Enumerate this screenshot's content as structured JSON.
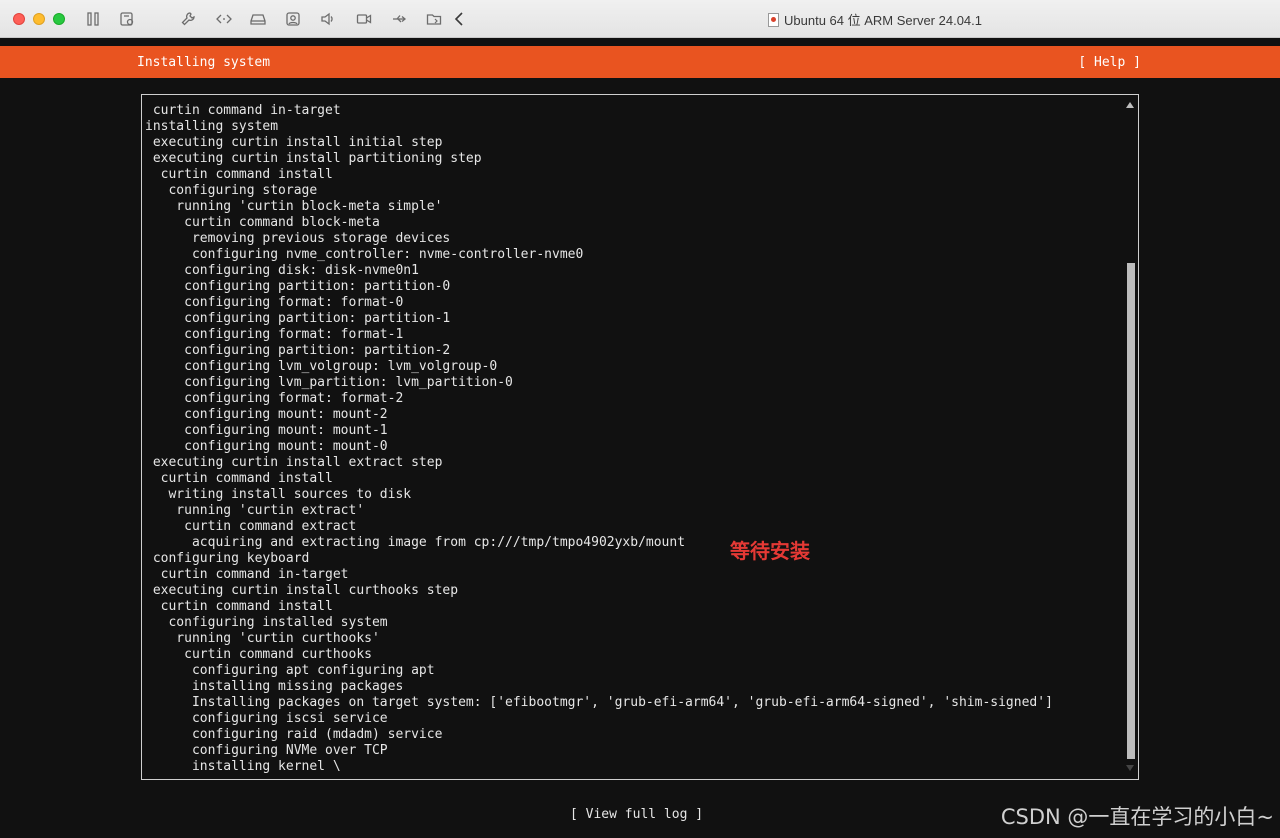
{
  "window": {
    "title": "Ubuntu 64 位 ARM Server 24.04.1",
    "toolbar_icons": [
      "pause-icon",
      "settings-icon",
      "wrench-icon",
      "code-icon",
      "drive-icon",
      "camera-icon",
      "sound-icon",
      "video-icon",
      "usb-icon",
      "shared-folder-icon",
      "back-icon"
    ]
  },
  "installer": {
    "header_title": "Installing system",
    "help_label": "[ Help ]",
    "view_log_label": "[ View full log ]",
    "log_lines": [
      " curtin command in-target",
      "installing system",
      " executing curtin install initial step",
      " executing curtin install partitioning step",
      "  curtin command install",
      "   configuring storage",
      "    running 'curtin block-meta simple'",
      "     curtin command block-meta",
      "      removing previous storage devices",
      "      configuring nvme_controller: nvme-controller-nvme0",
      "     configuring disk: disk-nvme0n1",
      "     configuring partition: partition-0",
      "     configuring format: format-0",
      "     configuring partition: partition-1",
      "     configuring format: format-1",
      "     configuring partition: partition-2",
      "     configuring lvm_volgroup: lvm_volgroup-0",
      "     configuring lvm_partition: lvm_partition-0",
      "     configuring format: format-2",
      "     configuring mount: mount-2",
      "     configuring mount: mount-1",
      "     configuring mount: mount-0",
      " executing curtin install extract step",
      "  curtin command install",
      "   writing install sources to disk",
      "    running 'curtin extract'",
      "     curtin command extract",
      "      acquiring and extracting image from cp:///tmp/tmpo4902yxb/mount",
      " configuring keyboard",
      "  curtin command in-target",
      " executing curtin install curthooks step",
      "  curtin command install",
      "   configuring installed system",
      "    running 'curtin curthooks'",
      "     curtin command curthooks",
      "      configuring apt configuring apt",
      "      installing missing packages",
      "      Installing packages on target system: ['efibootmgr', 'grub-efi-arm64', 'grub-efi-arm64-signed', 'shim-signed']",
      "      configuring iscsi service",
      "      configuring raid (mdadm) service",
      "      configuring NVMe over TCP",
      "      installing kernel \\"
    ]
  },
  "annotation": "等待安装",
  "watermark": "CSDN @一直在学习的小白~",
  "colors": {
    "accent": "#e95420",
    "terminal_bg": "#111111",
    "annotation": "#e53935"
  }
}
